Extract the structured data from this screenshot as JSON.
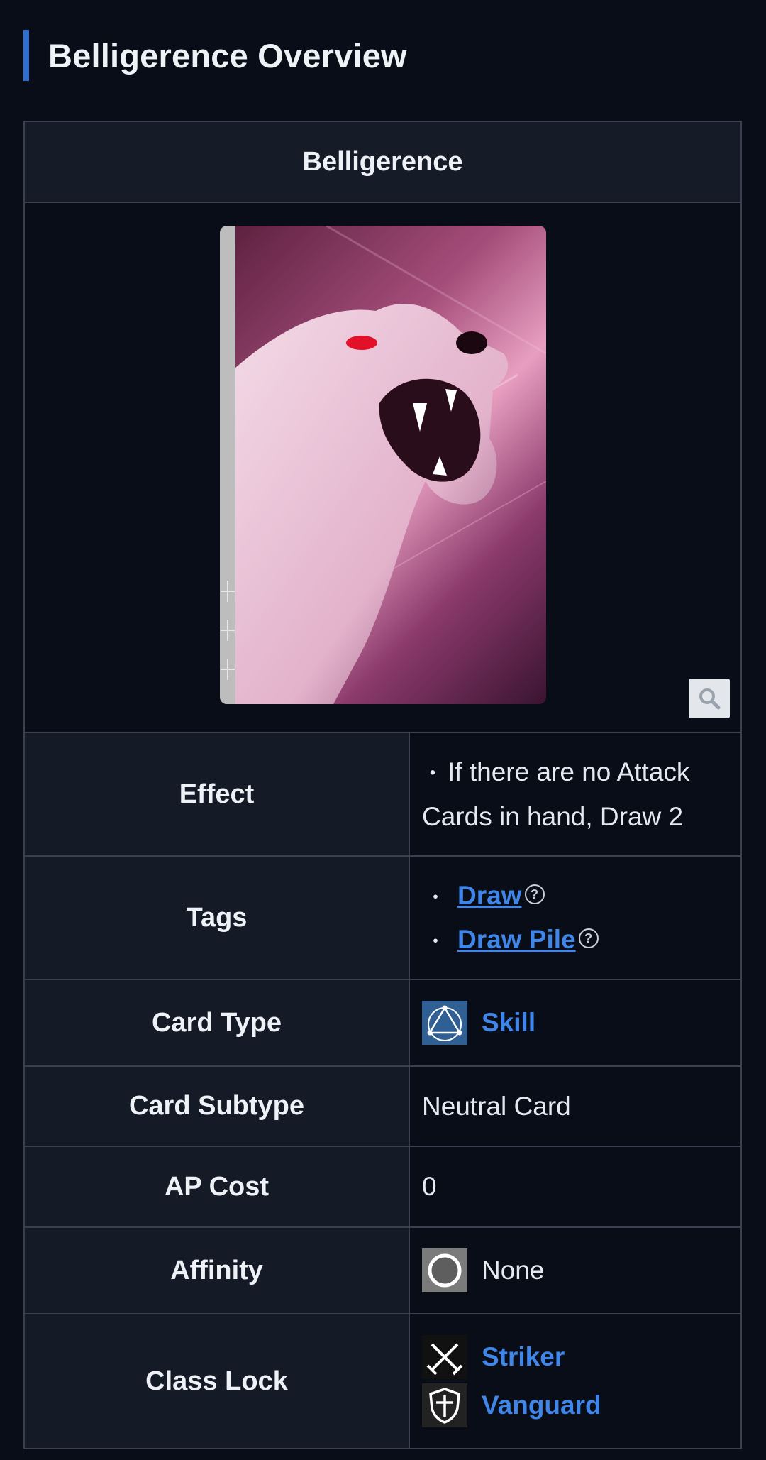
{
  "page": {
    "heading": "Belligerence Overview"
  },
  "infobox": {
    "title": "Belligerence",
    "rows": {
      "effect": {
        "label": "Effect",
        "value": "If there are no Attack Cards in hand, Draw 2",
        "bullet": "・"
      },
      "tags": {
        "label": "Tags",
        "items": [
          "Draw",
          "Draw Pile"
        ],
        "bullet": "・",
        "help_glyph": "?"
      },
      "card_type": {
        "label": "Card Type",
        "value": "Skill",
        "icon": "skill-triangle-icon"
      },
      "card_subtype": {
        "label": "Card Subtype",
        "value": "Neutral Card"
      },
      "ap_cost": {
        "label": "AP Cost",
        "value": "0"
      },
      "affinity": {
        "label": "Affinity",
        "value": "None",
        "icon": "circle-icon"
      },
      "class_lock": {
        "label": "Class Lock",
        "items": [
          "Striker",
          "Vanguard"
        ],
        "icons": [
          "crossed-swords-icon",
          "shield-icon"
        ]
      }
    }
  },
  "colors": {
    "accent": "#2f6fd1",
    "link": "#3f86e8",
    "background": "#080d17",
    "label_bg": "#141a26"
  }
}
